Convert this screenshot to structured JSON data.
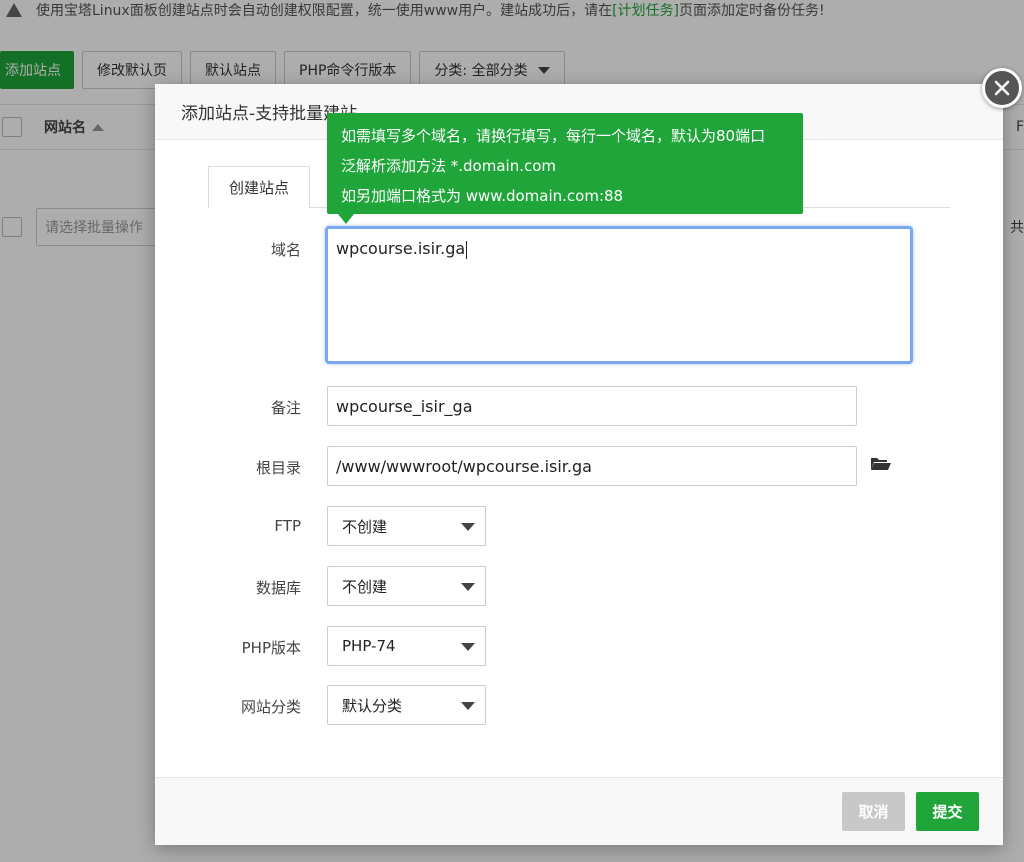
{
  "background": {
    "notice": {
      "prefix": "使用宝塔Linux面板创建站点时会自动创建权限配置，统一使用www用户。建站成功后，请在",
      "link": "[计划任务]",
      "suffix": "页面添加定时备份任务!"
    },
    "toolbar": {
      "add_site": "添加站点",
      "modify_default_page": "修改默认页",
      "default_site": "默认站点",
      "php_cli_version": "PHP命令行版本",
      "category_filter": "分类: 全部分类"
    },
    "table": {
      "col_site_name": "网站名",
      "col_right_partial": "F"
    },
    "batch": {
      "placeholder": "请选择批量操作",
      "right_partial": "共"
    }
  },
  "modal": {
    "title": "添加站点-支持批量建站",
    "tab_create": "创建站点",
    "tooltip": {
      "line1": "如需填写多个域名，请换行填写，每行一个域名，默认为80端口",
      "line2": "泛解析添加方法 *.domain.com",
      "line3": "如另加端口格式为 www.domain.com:88"
    },
    "fields": {
      "domain_label": "域名",
      "domain_value": "wpcourse.isir.ga",
      "remark_label": "备注",
      "remark_value": "wpcourse_isir_ga",
      "root_label": "根目录",
      "root_value": "/www/wwwroot/wpcourse.isir.ga",
      "ftp_label": "FTP",
      "ftp_value": "不创建",
      "db_label": "数据库",
      "db_value": "不创建",
      "php_label": "PHP版本",
      "php_value": "PHP-74",
      "category_label": "网站分类",
      "category_value": "默认分类"
    },
    "buttons": {
      "cancel": "取消",
      "submit": "提交"
    }
  },
  "icons": {
    "warning": "warning-icon",
    "close": "close-icon",
    "folder": "folder-open-icon",
    "sort": "sort-up-icon",
    "dropdown": "chevron-down-icon"
  },
  "colors": {
    "brand_green": "#20a53a",
    "focus_blue": "#7aa8ee",
    "cancel_gray": "#c8c8c8"
  }
}
